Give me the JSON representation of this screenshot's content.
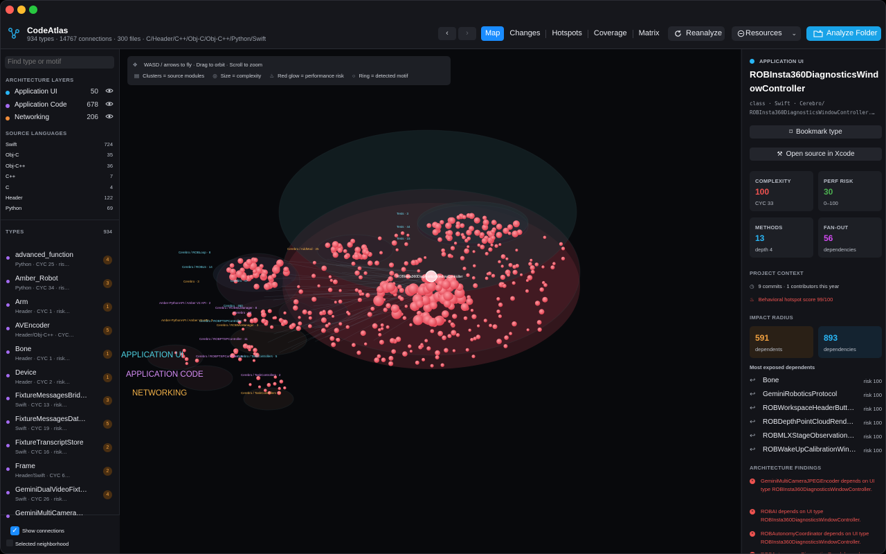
{
  "app": {
    "title": "CodeAtlas",
    "subtitle": "934 types · 14767 connections · 300 files · C/Header/C++/Obj-C/Obj-C++/Python/Swift"
  },
  "toolbar": {
    "back": "‹",
    "forward": "›",
    "modes": [
      "Map",
      "Changes",
      "Hotspots",
      "Coverage",
      "Matrix"
    ],
    "reanalyze": "Reanalyze",
    "resources": "Resources",
    "analyze_folder": "Analyze Folder"
  },
  "sidebar": {
    "search_placeholder": "Find type or motif",
    "layers_title": "ARCHITECTURE LAYERS",
    "layers": [
      {
        "name": "Application UI",
        "count": "50",
        "color": "#29b6f6"
      },
      {
        "name": "Application Code",
        "count": "678",
        "color": "#a46bf0"
      },
      {
        "name": "Networking",
        "count": "206",
        "color": "#f08c3a"
      }
    ],
    "languages_title": "SOURCE LANGUAGES",
    "languages": [
      {
        "name": "Swift",
        "count": "724"
      },
      {
        "name": "Obj-C",
        "count": "35"
      },
      {
        "name": "Obj-C++",
        "count": "36"
      },
      {
        "name": "C++",
        "count": "7"
      },
      {
        "name": "C",
        "count": "4"
      },
      {
        "name": "Header",
        "count": "122"
      },
      {
        "name": "Python",
        "count": "69"
      }
    ],
    "types_title": "TYPES",
    "types_count": "934",
    "types": [
      {
        "name": "advanced_function",
        "meta": "Python · CYC 25 · ris…",
        "badge": "4"
      },
      {
        "name": "Amber_Robot",
        "meta": "Python · CYC 34 · ris…",
        "badge": "3"
      },
      {
        "name": "Arm",
        "meta": "Header · CYC 1 · risk…",
        "badge": "1"
      },
      {
        "name": "AVEncoder",
        "meta": "Header/Obj-C++ · CYC…",
        "badge": "5"
      },
      {
        "name": "Bone",
        "meta": "Header · CYC 1 · risk…",
        "badge": "1"
      },
      {
        "name": "Device",
        "meta": "Header · CYC 2 · risk…",
        "badge": "1"
      },
      {
        "name": "FixtureMessagesBrid…",
        "meta": "Swift · CYC 13 · risk…",
        "badge": "3"
      },
      {
        "name": "FixtureMessagesDat…",
        "meta": "Swift · CYC 19 · risk…",
        "badge": "5"
      },
      {
        "name": "FixtureTranscriptStore",
        "meta": "Swift · CYC 16 · risk…",
        "badge": "2"
      },
      {
        "name": "Frame",
        "meta": "Header/Swift · CYC 6…",
        "badge": "2"
      },
      {
        "name": "GeminiDualVideoFixt…",
        "meta": "Swift · CYC 26 · risk…",
        "badge": "4"
      },
      {
        "name": "GeminiMultiCamera…",
        "meta": "",
        "badge": ""
      }
    ],
    "show_connections": "Show connections",
    "selected_neighborhood": "Selected neighborhood"
  },
  "canvas": {
    "hint_line1": "WASD / arrows to fly · Drag to orbit · Scroll to zoom",
    "hint_items": [
      "Clusters = source modules",
      "Size = complexity",
      "Red glow = performance risk",
      "Ring = detected motif"
    ],
    "layer_labels": [
      {
        "text": "APPLICATION UI",
        "color": "#4dd0e1"
      },
      {
        "text": "APPLICATION CODE",
        "color": "#d58cf5"
      },
      {
        "text": "NETWORKING",
        "color": "#f0b048"
      }
    ],
    "cluster_labels": [
      "Cerebro / ROBLoop · 8",
      "Cerebro / ROBL5 · 14",
      "Cerebro · 67",
      "Cerebro · 460",
      "Cerebro / ROBMLManager · 8",
      "Cerebro · 33",
      "Cerebro / ROBMLManager · 3",
      "Cerebro / ROBPTSPController · 7",
      "Cerebro / ROBPTSPController · 11",
      "Cerebro / ROBPTSPController · 6",
      "Cerebro / TaskControllers · 5",
      "Cerebro / TaskControllers · 2",
      "Cerebro / TaskControllers · 3",
      "Amber-PythonAPI / Amber V2 API · 2",
      "Amber-PythonAPI / Amber V2 API · 3",
      "Tests · 3",
      "Tests · 44",
      "Tests · 15",
      "Cerebro / AddMod · 25",
      "Cerebro · 3"
    ],
    "selected_label": "ROBInsta360DiagnosticsWindowController"
  },
  "detail": {
    "layer": "APPLICATION UI",
    "title": "ROBInsta360DiagnosticsWindowController",
    "path": "class · Swift · Cerebro/\nROBInsta360DiagnosticsWindowController.…",
    "bookmark": "Bookmark type",
    "open_source": "Open source in Xcode",
    "metrics": [
      {
        "label": "COMPLEXITY",
        "value": "100",
        "sub": "CYC 33",
        "color": "#ef5350"
      },
      {
        "label": "PERF RISK",
        "value": "30",
        "sub": "0–100",
        "color": "#4caf50"
      },
      {
        "label": "METHODS",
        "value": "13",
        "sub": "depth 4",
        "color": "#29b6f6"
      },
      {
        "label": "FAN-OUT",
        "value": "56",
        "sub": "dependencies",
        "color": "#d04af0"
      }
    ],
    "context_title": "PROJECT CONTEXT",
    "commits": "9 commits · 1 contributors this year",
    "hotspot": "Behavioral hotspot score 99/100",
    "impact_title": "IMPACT RADIUS",
    "impact": [
      {
        "value": "591",
        "label": "dependents",
        "color": "#f0a040",
        "bg": "#2a2016"
      },
      {
        "value": "893",
        "label": "dependencies",
        "color": "#29b6f6",
        "bg": "#142330"
      }
    ],
    "exposed_title": "Most exposed dependents",
    "exposed": [
      {
        "name": "Bone",
        "risk": "risk 100"
      },
      {
        "name": "GeminiRoboticsProtocol",
        "risk": "risk 100"
      },
      {
        "name": "ROBWorkspaceHeaderButt…",
        "risk": "risk 100"
      },
      {
        "name": "ROBDepthPointCloudRend…",
        "risk": "risk 100"
      },
      {
        "name": "ROBMLXStageObservation…",
        "risk": "risk 100"
      },
      {
        "name": "ROBWakeUpCalibrationWin…",
        "risk": "risk 100"
      }
    ],
    "findings_title": "ARCHITECTURE FINDINGS",
    "findings": [
      "GeminiMultiCameraJPEGEncoder depends on UI type ROBInsta360DiagnosticsWindowController.",
      "ROBAI depends on UI type ROBInsta360DiagnosticsWindowController.",
      "ROBAutonomyCoordinator depends on UI type ROBInsta360DiagnosticsWindowController.",
      "ROBAutonomousDiagnosticsPanel depends on…"
    ]
  }
}
